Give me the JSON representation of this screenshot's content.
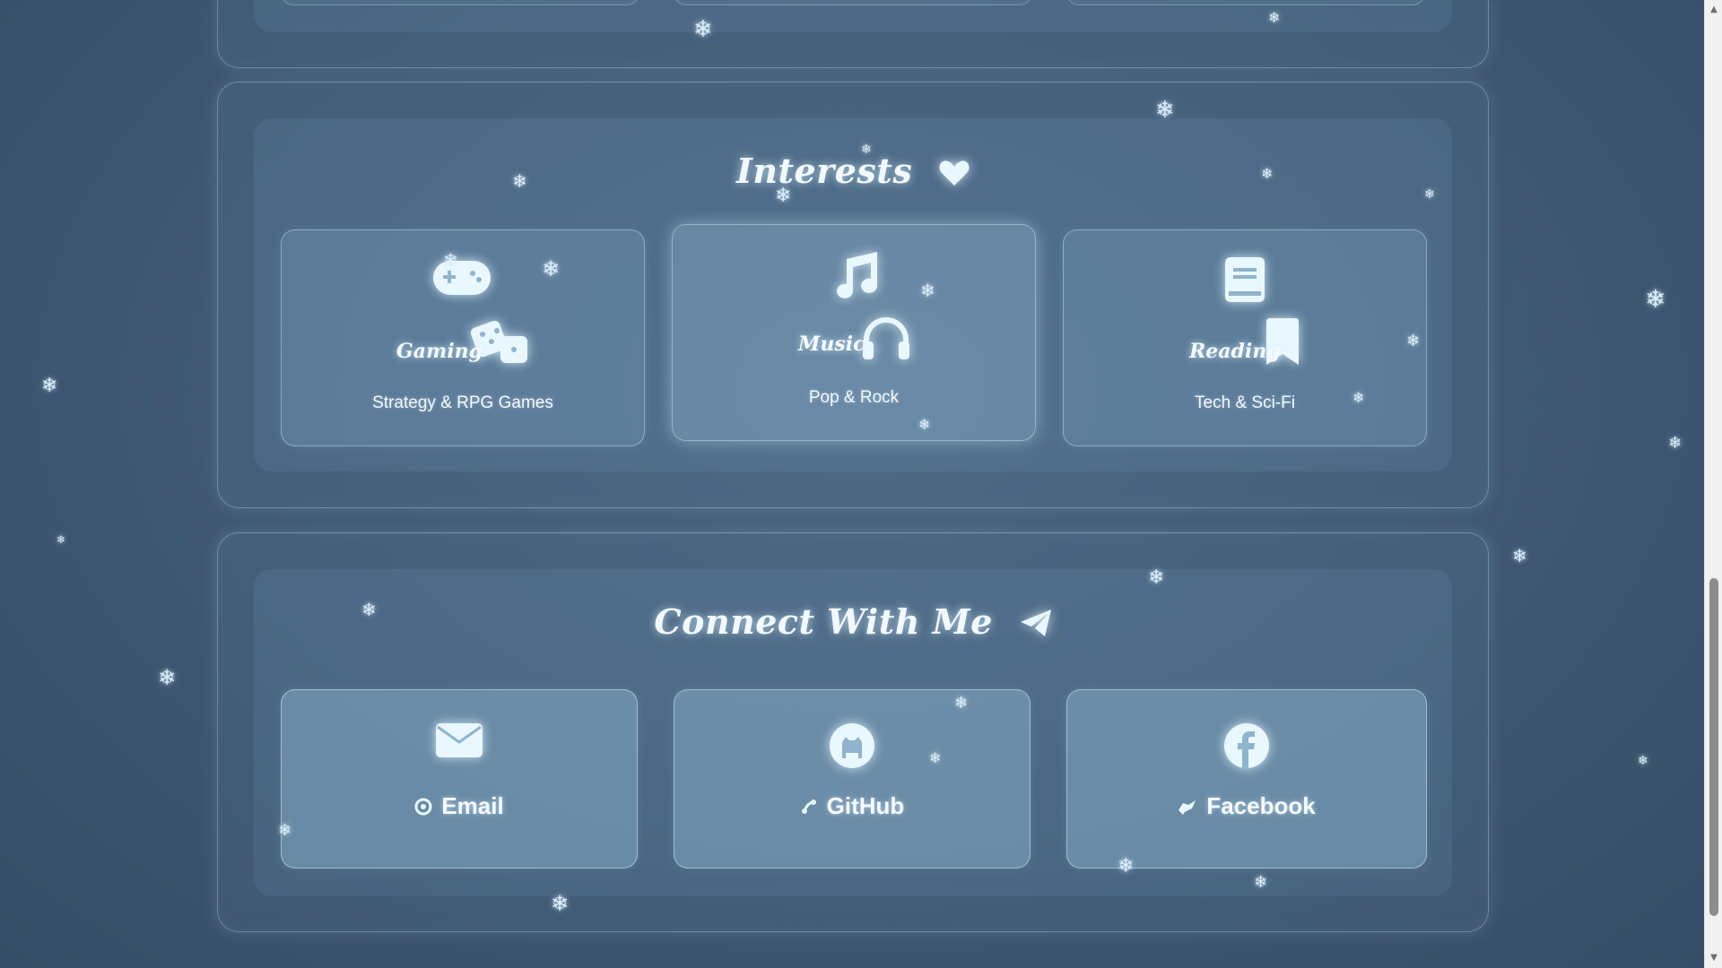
{
  "interests": {
    "title": "Interests",
    "title_icon": "heart-icon",
    "cards": [
      {
        "label": "Gaming",
        "description": "Strategy & RPG Games",
        "icons": [
          "gamepad-icon",
          "dice-icon"
        ]
      },
      {
        "label": "Music",
        "description": "Pop & Rock",
        "icons": [
          "music-note-icon",
          "headphones-icon"
        ]
      },
      {
        "label": "Reading",
        "description": "Tech & Sci-Fi",
        "icons": [
          "book-icon",
          "bookmark-icon"
        ]
      }
    ]
  },
  "connect": {
    "title": "Connect With Me",
    "title_icon": "paper-plane-icon",
    "cards": [
      {
        "label": "Email",
        "icon": "envelope-icon",
        "mini_icon": "swirl-icon"
      },
      {
        "label": "GitHub",
        "icon": "github-icon",
        "mini_icon": "branch-icon"
      },
      {
        "label": "Facebook",
        "icon": "facebook-icon",
        "mini_icon": "bird-icon"
      }
    ]
  },
  "decor": {
    "snowflake_glyph": "❄",
    "accent_color": "#e6f6ff"
  }
}
